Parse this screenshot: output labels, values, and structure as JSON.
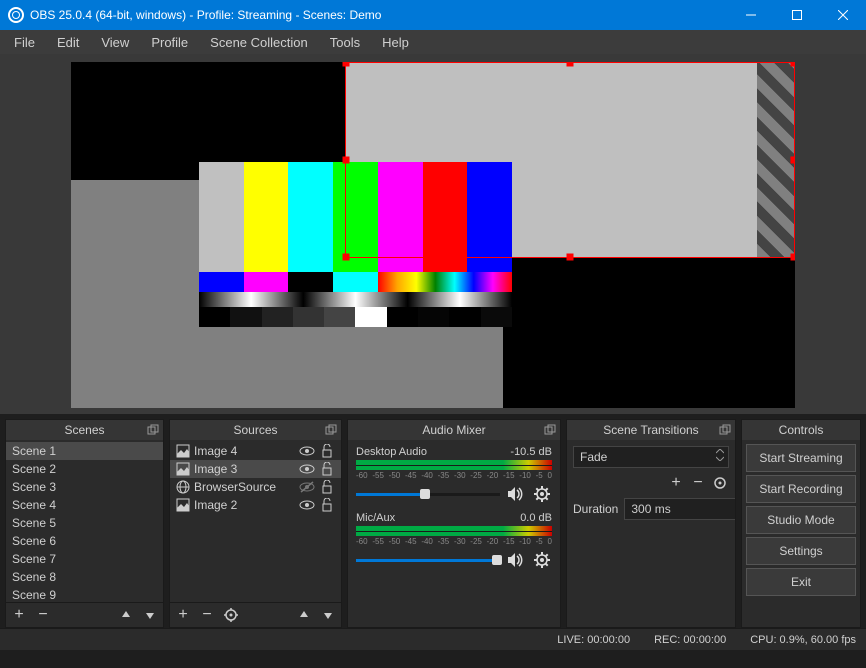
{
  "titlebar": {
    "title": "OBS 25.0.4 (64-bit, windows) - Profile: Streaming - Scenes: Demo"
  },
  "menu": {
    "file": "File",
    "edit": "Edit",
    "view": "View",
    "profile": "Profile",
    "scene_collection": "Scene Collection",
    "tools": "Tools",
    "help": "Help"
  },
  "panels": {
    "scenes": {
      "title": "Scenes",
      "items": [
        "Scene 1",
        "Scene 2",
        "Scene 3",
        "Scene 4",
        "Scene 5",
        "Scene 6",
        "Scene 7",
        "Scene 8",
        "Scene 9"
      ],
      "selected_index": 0
    },
    "sources": {
      "title": "Sources",
      "items": [
        {
          "name": "Image 4",
          "icon": "image",
          "visible": true,
          "locked": false,
          "selected": false
        },
        {
          "name": "Image 3",
          "icon": "image",
          "visible": true,
          "locked": false,
          "selected": true
        },
        {
          "name": "BrowserSource",
          "icon": "globe",
          "visible": false,
          "locked": false,
          "selected": false
        },
        {
          "name": "Image 2",
          "icon": "image",
          "visible": true,
          "locked": false,
          "selected": false
        }
      ]
    },
    "mixer": {
      "title": "Audio Mixer",
      "channels": [
        {
          "name": "Desktop Audio",
          "db": "-10.5 dB",
          "slider_pct": 48
        },
        {
          "name": "Mic/Aux",
          "db": "0.0 dB",
          "slider_pct": 98
        }
      ],
      "scale": [
        "-60",
        "-55",
        "-50",
        "-45",
        "-40",
        "-35",
        "-30",
        "-25",
        "-20",
        "-15",
        "-10",
        "-5",
        "0"
      ]
    },
    "transitions": {
      "title": "Scene Transitions",
      "selected": "Fade",
      "duration_label": "Duration",
      "duration": "300 ms"
    },
    "controls": {
      "title": "Controls",
      "buttons": [
        "Start Streaming",
        "Start Recording",
        "Studio Mode",
        "Settings",
        "Exit"
      ]
    }
  },
  "status": {
    "live": "LIVE: 00:00:00",
    "rec": "REC: 00:00:00",
    "cpu": "CPU: 0.9%, 60.00 fps"
  }
}
